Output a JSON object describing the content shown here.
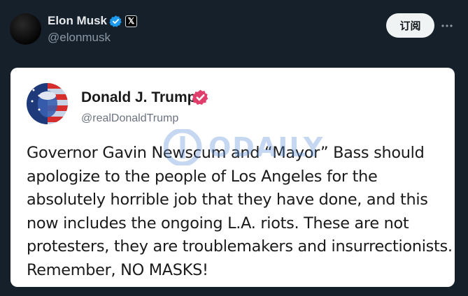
{
  "post": {
    "author_name": "Elon Musk",
    "author_handle": "@elonmusk",
    "follow_label": "订阅",
    "badge_letter": "𝕏"
  },
  "embedded": {
    "name": "Donald J. Trump",
    "handle": "@realDonaldTrump",
    "text_lines": [
      "Governor Gavin Newscum and “Mayor” Bass should",
      "apologize to the people of Los Angeles for the",
      "absolutely horrible job that they have done, and this",
      "now includes the ongoing L.A. riots. These are not",
      "protesters, they are troublemakers and insurrectionists.",
      "Remember, NO MASKS!"
    ],
    "watermark": "ODAILY"
  },
  "colors": {
    "background": "#15202b",
    "x_verified": "#1d9bf0",
    "truth_verified": "#e03e6c",
    "card": "#ffffff"
  },
  "icons": [
    "verified-badge-icon",
    "x-logo-icon",
    "more-options-icon",
    "truth-verified-icon",
    "odaily-logo-icon"
  ]
}
